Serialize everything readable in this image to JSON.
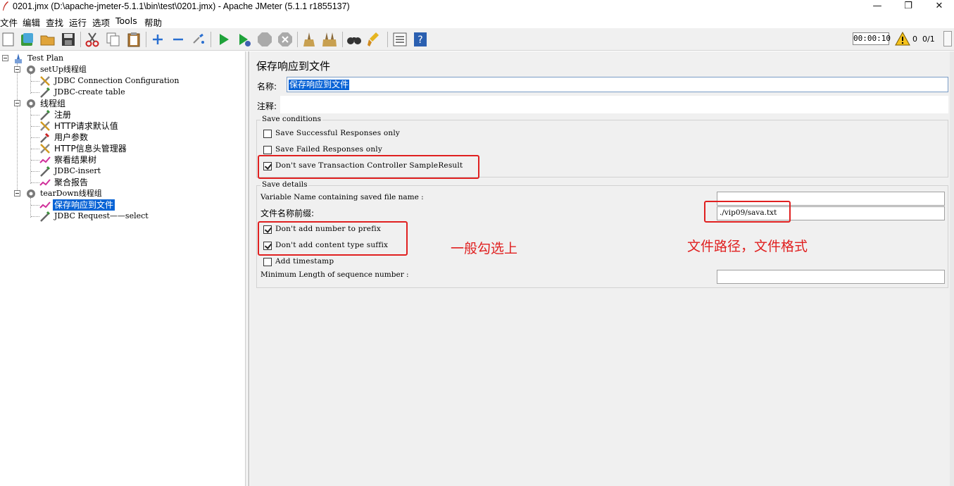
{
  "window": {
    "title": "0201.jmx (D:\\apache-jmeter-5.1.1\\bin\\test\\0201.jmx) - Apache JMeter (5.1.1 r1855137)",
    "minimize": "—",
    "maximize": "❐",
    "close": "✕"
  },
  "menu": [
    "文件",
    "编辑",
    "查找",
    "运行",
    "选项",
    "Tools",
    "帮助"
  ],
  "toolbar": {
    "icons": [
      "new-icon",
      "templates-icon",
      "open-icon",
      "save-icon",
      "cut-icon",
      "copy-icon",
      "paste-icon",
      "expand-icon",
      "collapse-icon",
      "toggle-icon",
      "start-icon",
      "start-no-pause-icon",
      "stop-icon",
      "shutdown-icon",
      "clear-icon",
      "clear-all-icon",
      "search-icon",
      "reset-search-icon",
      "function-helper-icon",
      "help-icon"
    ],
    "timer": "00:00:10",
    "warnings": "0",
    "threads": "0/1"
  },
  "tree": {
    "test_plan": "Test Plan",
    "setup_group": "setUp线程组",
    "jdbc_config": "JDBC Connection Configuration",
    "jdbc_create": "JDBC-create table",
    "thread_group": "线程组",
    "register": "注册",
    "http_defaults": "HTTP请求默认值",
    "user_params": "用户参数",
    "http_header": "HTTP信息头管理器",
    "view_results": "察看结果树",
    "jdbc_insert": "JDBC-insert",
    "aggregate": "聚合报告",
    "teardown_group": "tearDown线程组",
    "save_responses": "保存响应到文件",
    "jdbc_select": "JDBC Request——select"
  },
  "panel": {
    "title": "保存响应到文件",
    "name_label": "名称:",
    "name_value": "保存响应到文件",
    "comment_label": "注释:",
    "save_conditions": {
      "title": "Save conditions",
      "successful": "Save Successful Responses only",
      "failed": "Save Failed Responses only",
      "no_transaction": "Don't save Transaction Controller SampleResult"
    },
    "save_details": {
      "title": "Save details",
      "variable_name_label": "Variable Name containing saved file name :",
      "prefix_label": "文件名称前缀:",
      "prefix_value": "./vip09/sava.txt",
      "no_number": "Don't add number to prefix",
      "no_content_type": "Don't add content type suffix",
      "timestamp": "Add timestamp",
      "min_length_label": "Minimum Length of sequence number :"
    }
  },
  "annotations": {
    "check_note": "一般勾选上",
    "path_note": "文件路径，文件格式"
  },
  "checkbox_state": {
    "successful": false,
    "failed": false,
    "no_transaction": true,
    "no_number": true,
    "no_content_type": true,
    "timestamp": false
  },
  "colors": {
    "annotation": "#e02020",
    "selection": "#0a64d6"
  }
}
